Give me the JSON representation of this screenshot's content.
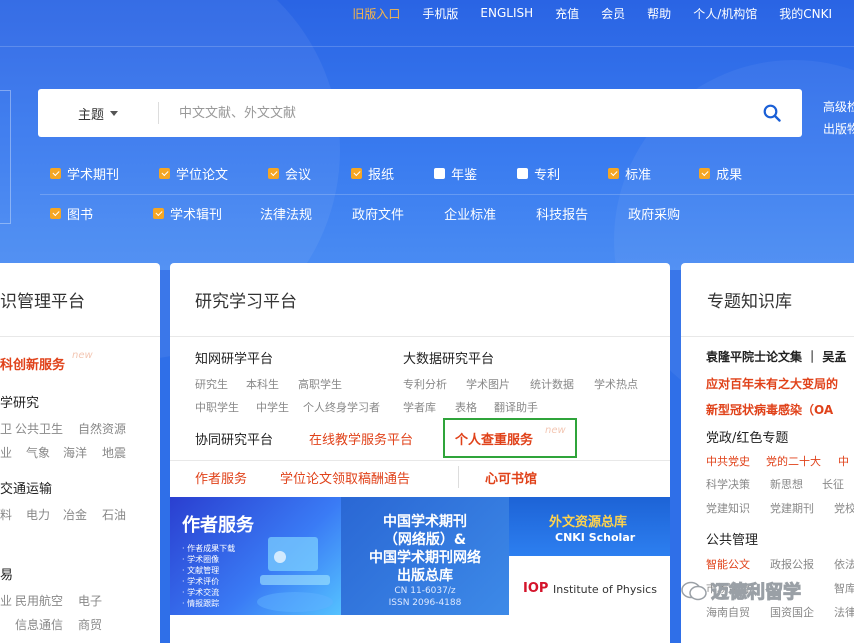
{
  "colors": {
    "accent": "#2a64e4",
    "checked": "#f5a623",
    "red": "#e0421a",
    "highlight_border": "#2fa43a"
  },
  "topnav": [
    "旧版入口",
    "手机版",
    "ENGLISH",
    "充值",
    "会员",
    "帮助",
    "个人/机构馆",
    "我的CNKI"
  ],
  "search": {
    "scope": "主题",
    "placeholder": "中文文献、外文文献",
    "adv1": "高级检",
    "adv2": "出版物"
  },
  "filters_row1": [
    {
      "label": "学术期刊",
      "checked": true
    },
    {
      "label": "学位论文",
      "checked": true
    },
    {
      "label": "会议",
      "checked": true
    },
    {
      "label": "报纸",
      "checked": true
    },
    {
      "label": "年鉴",
      "checked": false
    },
    {
      "label": "专利",
      "checked": false
    },
    {
      "label": "标准",
      "checked": true
    },
    {
      "label": "成果",
      "checked": true
    }
  ],
  "filters_row2": [
    {
      "label": "图书",
      "checked": true
    },
    {
      "label": "学术辑刊",
      "checked": true
    },
    {
      "label": "法律法规"
    },
    {
      "label": "政府文件"
    },
    {
      "label": "企业标准"
    },
    {
      "label": "科技报告"
    },
    {
      "label": "政府采购"
    }
  ],
  "left_panel": {
    "title": "识管理平台",
    "item1": "科创新服务",
    "new": "new",
    "item2": "学研究",
    "r1": [
      "卫",
      "公共卫生",
      "自然资源"
    ],
    "r2": [
      "业",
      "气象",
      "海洋",
      "地震"
    ],
    "item3": "交通运输",
    "r3": [
      "料",
      "电力",
      "冶金",
      "石油"
    ],
    "item4": "易",
    "r4": [
      "业",
      "民用航空",
      "电子"
    ],
    "r5": [
      "",
      "信息通信",
      "商贸"
    ]
  },
  "mid_panel": {
    "title": "研究学习平台",
    "a_title": "知网研学平台",
    "a_r1": [
      "研究生",
      "本科生",
      "高职学生"
    ],
    "a_r2": [
      "中职学生",
      "中学生",
      "个人终身学习者"
    ],
    "b_title": "大数据研究平台",
    "b_r1": [
      "专利分析",
      "学术图片",
      "统计数据",
      "学术热点"
    ],
    "b_r2": [
      "学者库",
      "表格",
      "翻译助手"
    ],
    "c1": "协同研究平台",
    "c2": "在线教学服务平台",
    "c3": "个人查重服务",
    "d1": "作者服务",
    "d2": "学位论文领取稿酬通告",
    "d3": "心可书馆",
    "new": "new"
  },
  "banners": {
    "b1_title": "作者服务",
    "b1_items": [
      "· 作者成果下载",
      "· 学术圈像",
      "· 文献管理",
      "· 学术评价",
      "· 学术交流",
      "· 情报跟踪"
    ],
    "b2_l1": "中国学术期刊",
    "b2_l2": "（网络版）&",
    "b2_l3": "中国学术期刊网络",
    "b2_l4": "出版总库",
    "b2_l5": "CN 11-6037/z",
    "b2_l6": "ISSN 2096-4188",
    "b3_title": "外文资源总库",
    "b3_sub": "CNKI Scholar",
    "b3_iop1": "IOP",
    "b3_iop2": "Institute of Physics"
  },
  "right_panel": {
    "title": "专题知识库",
    "l1": "袁隆平院士论文集 ｜ 吴孟",
    "l2": "应对百年未有之大变局的",
    "l3": "新型冠状病毒感染（OA",
    "l4": "党政/红色专题",
    "r1": [
      "中共党史",
      "党的二十大",
      "中"
    ],
    "r2": [
      "科学决策",
      "新思想",
      "长征"
    ],
    "r3": [
      "党建知识",
      "党建期刊",
      "党校"
    ],
    "l5": "公共管理",
    "r4": [
      "智能公文",
      "政报公报",
      "依法"
    ],
    "r5": [
      "市场监管",
      "",
      "智库"
    ],
    "r6": [
      "海南自贸",
      "国资国企",
      "法律"
    ]
  },
  "watermark": "迈德利留学"
}
